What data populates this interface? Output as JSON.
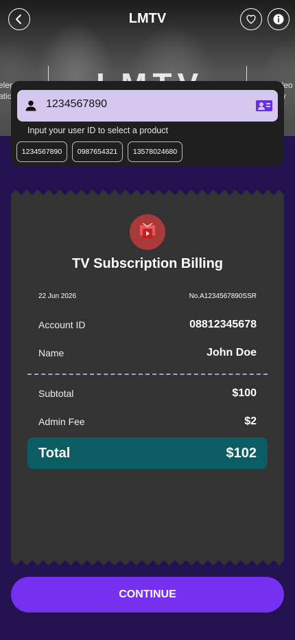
{
  "header": {
    "title": "LMTV",
    "back_icon": "chevron-left-icon",
    "favorite_icon": "heart-icon",
    "info_icon": "info-icon"
  },
  "banner": {
    "brand_text": "LMTV",
    "left_text_1": "elega",
    "left_text_2": "atio",
    "right_text_1": "meleo",
    "right_text_2": "auty"
  },
  "user_input": {
    "icon": "person-icon",
    "value": "1234567890",
    "contact_icon": "contact-card-icon",
    "hint": "Input your user ID to select a product",
    "suggestions": [
      "1234567890",
      "0987654321",
      "13578024680"
    ]
  },
  "receipt": {
    "logo_icon": "tv-play-icon",
    "title": "TV Subscription Billing",
    "date": "22 Jun 2026",
    "number": "No.A1234567890SSR",
    "account_label": "Account ID",
    "account_value": "08812345678",
    "name_label": "Name",
    "name_value": "John Doe",
    "subtotal_label": "Subtotal",
    "subtotal_value": "$100",
    "admin_fee_label": "Admin Fee",
    "admin_fee_value": "$2",
    "total_label": "Total",
    "total_value": "$102"
  },
  "footer": {
    "continue_label": "CONTINUE"
  },
  "colors": {
    "background": "#22124f",
    "accent": "#7530f0",
    "input_bg": "#d4c8ef",
    "total_bg": "#0c5c63",
    "receipt_bg": "#333333"
  }
}
